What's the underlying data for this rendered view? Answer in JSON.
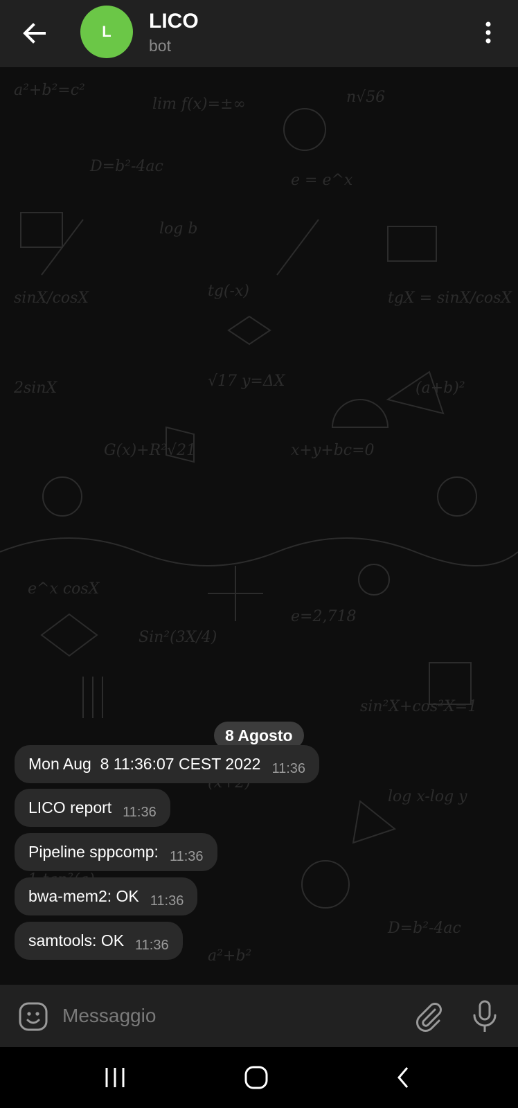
{
  "header": {
    "back_icon": "arrow-left-icon",
    "avatar_letter": "L",
    "avatar_color": "#6bc747",
    "title": "LICO",
    "subtitle": "bot",
    "menu_icon": "more-vertical-icon"
  },
  "chat": {
    "date_label": "8 Agosto",
    "messages": [
      {
        "text": "Mon Aug  8 11:36:07 CEST 2022",
        "time": "11:36"
      },
      {
        "text": "LICO report",
        "time": "11:36"
      },
      {
        "text": "Pipeline sppcomp:",
        "time": "11:36"
      },
      {
        "text": "bwa-mem2: OK",
        "time": "11:36"
      },
      {
        "text": "samtools: OK",
        "time": "11:36"
      }
    ]
  },
  "input_bar": {
    "emoji_icon": "emoji-icon",
    "placeholder": "Messaggio",
    "value": "",
    "attach_icon": "paperclip-icon",
    "mic_icon": "microphone-icon"
  },
  "navbar": {
    "recent_icon": "recent-apps-icon",
    "home_icon": "home-icon",
    "back_icon": "nav-back-icon"
  },
  "colors": {
    "header_bg": "#212121",
    "bubble_bg": "#2a2a2a",
    "chat_bg": "#0e0e0e",
    "date_pill_bg": "#3c3c3c"
  }
}
